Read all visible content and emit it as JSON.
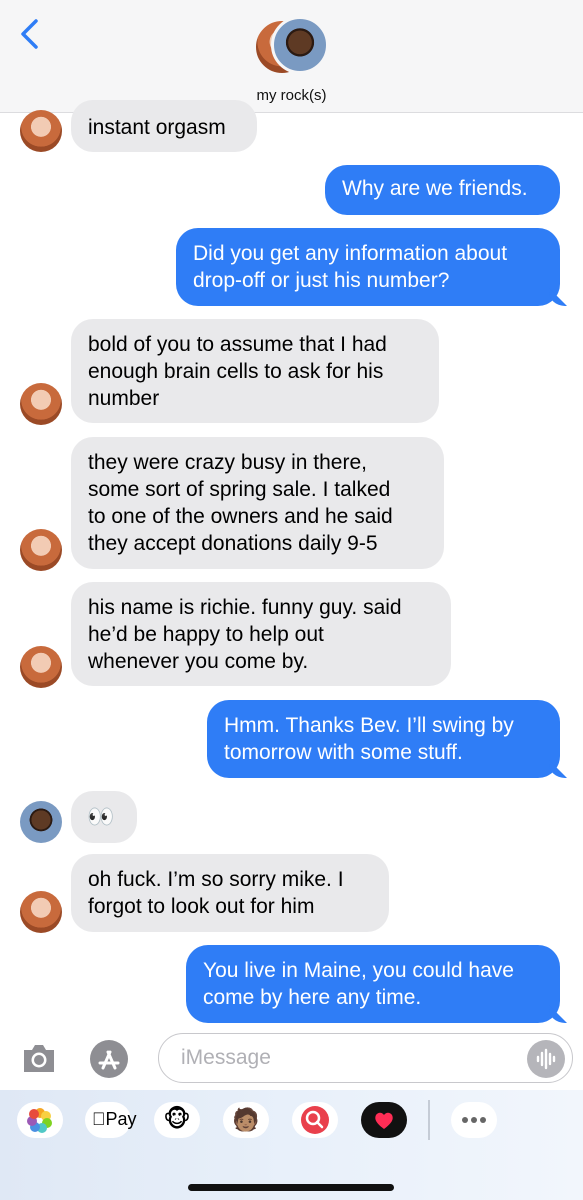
{
  "header": {
    "contact_name": "my rock(s)"
  },
  "messages": [
    {
      "dir": "received",
      "text": "instant orgasm"
    },
    {
      "dir": "sent",
      "text": "Why are we friends."
    },
    {
      "dir": "sent",
      "lines": [
        "Did you get any information about",
        "drop-off or just his number?"
      ]
    },
    {
      "dir": "received",
      "lines": [
        "bold of you to assume that I had",
        "enough brain cells to ask for his",
        "number"
      ]
    },
    {
      "dir": "received",
      "lines": [
        "they were crazy busy in there,",
        "some sort of spring sale. I talked",
        "to one of the owners and he said",
        "they accept donations daily 9-5"
      ]
    },
    {
      "dir": "received",
      "lines": [
        "his name is richie. funny guy. said",
        "he’d be happy to help out",
        "whenever you come by."
      ]
    },
    {
      "dir": "sent",
      "lines": [
        "Hmm. Thanks Bev. I’ll swing by",
        "tomorrow with some stuff."
      ]
    },
    {
      "dir": "received",
      "text": "👀"
    },
    {
      "dir": "received",
      "lines": [
        "oh fuck. I’m so sorry mike. I",
        "forgot to look out for him"
      ]
    },
    {
      "dir": "sent",
      "lines": [
        "You live in Maine, you could have",
        "come by here any time."
      ]
    }
  ],
  "composer": {
    "placeholder": "iMessage"
  },
  "apps": {
    "apple_pay_label": "Pay"
  },
  "colors": {
    "sent_bubble": "#2f7df6",
    "received_bubble": "#e9e9eb",
    "accent": "#2f7df6"
  }
}
